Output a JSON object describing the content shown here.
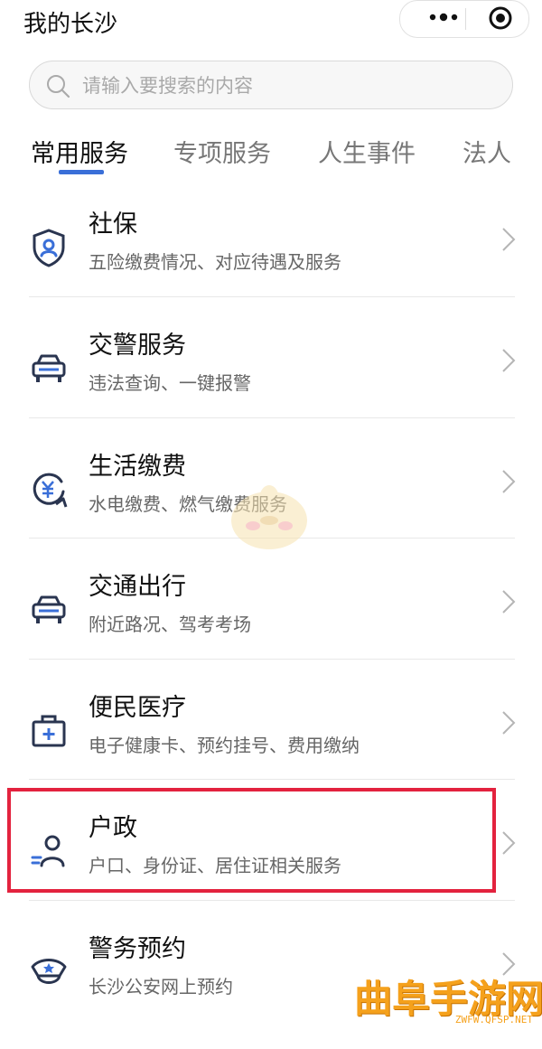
{
  "app": {
    "title": "我的长沙"
  },
  "search": {
    "placeholder": "请输入要搜索的内容"
  },
  "tabs": [
    {
      "label": "常用服务",
      "active": true
    },
    {
      "label": "专项服务",
      "active": false
    },
    {
      "label": "人生事件",
      "active": false
    },
    {
      "label": "法人",
      "active": false
    }
  ],
  "services": [
    {
      "label": "社保",
      "desc": "五险缴费情况、对应待遇及服务",
      "icon": "shield-user-icon"
    },
    {
      "label": "交警服务",
      "desc": "违法查询、一键报警",
      "icon": "car-icon"
    },
    {
      "label": "生活缴费",
      "desc": "水电缴费、燃气缴费服务",
      "icon": "yuan-refresh-icon"
    },
    {
      "label": "交通出行",
      "desc": "附近路况、驾考考场",
      "icon": "car-icon"
    },
    {
      "label": "便民医疗",
      "desc": "电子健康卡、预约挂号、费用缴纳",
      "icon": "medical-kit-icon"
    },
    {
      "label": "户政",
      "desc": "户口、身份证、居住证相关服务",
      "icon": "person-list-icon",
      "highlighted": true
    },
    {
      "label": "警务预约",
      "desc": "长沙公安网上预约",
      "icon": "police-cap-icon"
    }
  ],
  "watermark": {
    "text": "曲阜手游网",
    "url": "ZWFW.QFSP.NET"
  },
  "colors": {
    "accent": "#3a6fd8",
    "icon_dark": "#2a3550",
    "highlight": "#e3223e",
    "watermark": "#f5a11c"
  }
}
